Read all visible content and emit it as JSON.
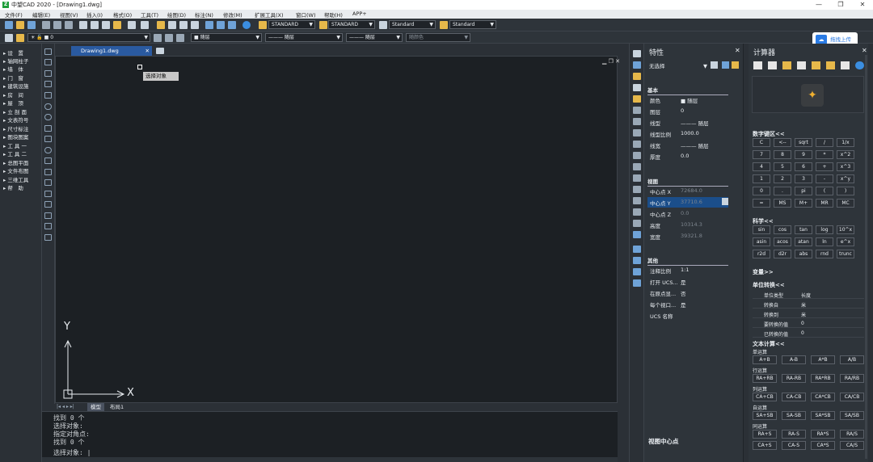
{
  "titlebar": {
    "app": "中望CAD 2020 - [Drawing1.dwg]",
    "logo": "Z"
  },
  "menu": [
    "文件(F)",
    "编辑(E)",
    "视图(V)",
    "插入(I)",
    "格式(O)",
    "工具(T)",
    "绘图(D)",
    "标注(N)",
    "修改(M)",
    "扩展工具(X)",
    "窗口(W)",
    "帮助(H)",
    "APP+"
  ],
  "toolbar1": {
    "text_style": "STANDARD",
    "dim_style": "STANDARD",
    "table_style": "Standard",
    "multileader_style": "Standard"
  },
  "toolbar2": {
    "layer": "0",
    "color": "随层",
    "linetype": "随层",
    "lineweight": "随层",
    "plotstyle": "随颜色"
  },
  "upload_label": "拖拽上传",
  "left_panel": [
    "设　置",
    "轴网柱子",
    "墙　体",
    "门　窗",
    "建筑设施",
    "房　间",
    "屋　顶",
    "立 剖 面",
    "文表符号",
    "尺寸标注",
    "图块图案",
    "工 具 一",
    "工 具 二",
    "总图平面",
    "文件布图",
    "三维工具",
    "帮　助"
  ],
  "doc_tab": "Drawing1.dwg",
  "tooltip": "选择对象",
  "axis": {
    "y": "Y",
    "x": "X"
  },
  "bottom_tabs": {
    "model": "模型",
    "layout": "布局1"
  },
  "command_lines": [
    "找到 0 个",
    "选择对象:",
    "指定对角点:",
    "找到 0 个",
    "选择对象:"
  ],
  "props": {
    "title": "特性",
    "selection": "无选择",
    "basic": {
      "title": "基本",
      "rows": [
        [
          "颜色",
          "■ 随层"
        ],
        [
          "图层",
          "0"
        ],
        [
          "线型",
          "——— 随层"
        ],
        [
          "线型比例",
          "1000.0"
        ],
        [
          "线宽",
          "——— 随层"
        ],
        [
          "厚度",
          "0.0"
        ]
      ]
    },
    "view": {
      "title": "视图",
      "rows": [
        [
          "中心点 X",
          "72684.0"
        ],
        [
          "中心点 Y",
          "37710.6"
        ],
        [
          "中心点 Z",
          "0.0"
        ],
        [
          "高度",
          "10314.3"
        ],
        [
          "宽度",
          "39321.8"
        ]
      ]
    },
    "other": {
      "title": "其他",
      "rows": [
        [
          "注释比例",
          "1:1"
        ],
        [
          "打开 UCS...",
          "是"
        ],
        [
          "在原点显...",
          "否"
        ],
        [
          "每个视口...",
          "是"
        ],
        [
          "UCS 名称",
          ""
        ]
      ]
    },
    "footer": "视图中心点"
  },
  "calc": {
    "title": "计算器",
    "keypad_title": "数字键区<<",
    "keypad": [
      [
        "C",
        "<--",
        "sqrt",
        "/",
        "1/x"
      ],
      [
        "7",
        "8",
        "9",
        "*",
        "x^2"
      ],
      [
        "4",
        "5",
        "6",
        "+",
        "x^3"
      ],
      [
        "1",
        "2",
        "3",
        "-",
        "x^y"
      ],
      [
        "0",
        ".",
        "pi",
        "(",
        ")"
      ],
      [
        "=",
        "MS",
        "M+",
        "MR",
        "MC"
      ]
    ],
    "sci_title": "科学<<",
    "sci": [
      [
        "sin",
        "cos",
        "tan",
        "log",
        "10^x"
      ],
      [
        "asin",
        "acos",
        "atan",
        "ln",
        "e^x"
      ],
      [
        "r2d",
        "d2r",
        "abs",
        "rnd",
        "trunc"
      ]
    ],
    "var_title": "变量>>",
    "unit_title": "单位转换<<",
    "units": [
      [
        "单位类型",
        "长度"
      ],
      [
        "转换自",
        "米"
      ],
      [
        "转换到",
        "米"
      ],
      [
        "要转换的值",
        "0"
      ],
      [
        "已转换的值",
        "0"
      ]
    ],
    "text_title": "文本计算<<",
    "groups": [
      {
        "name": "单运算",
        "keys": [
          "A+B",
          "A-B",
          "A*B",
          "A/B"
        ]
      },
      {
        "name": "行运算",
        "keys": [
          "RA+RB",
          "RA-RB",
          "RA*RB",
          "RA/RB"
        ]
      },
      {
        "name": "列运算",
        "keys": [
          "CA+CB",
          "CA-CB",
          "CA*CB",
          "CA/CB"
        ]
      },
      {
        "name": "自运算",
        "keys": [
          "SA+SB",
          "SA-SB",
          "SA*SB",
          "SA/SB"
        ]
      },
      {
        "name": "同运算",
        "keys": [
          "RA+S",
          "RA-S",
          "RA*S",
          "RA/S"
        ]
      },
      {
        "name": "",
        "keys": [
          "CA+S",
          "CA-S",
          "CA*S",
          "CA/S"
        ]
      }
    ]
  },
  "colors": {
    "accent": "#2a5aa0",
    "bg": "#2b3036",
    "canvas": "#1c2024"
  }
}
